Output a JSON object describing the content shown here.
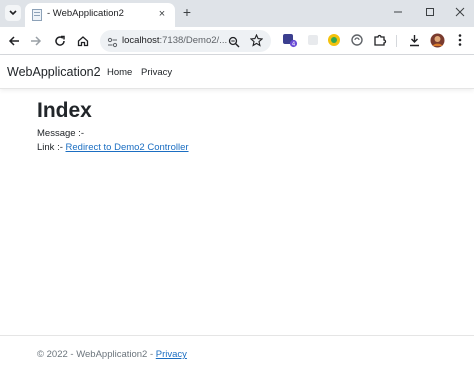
{
  "browser": {
    "tab": {
      "title": "- WebApplication2",
      "close": "×"
    },
    "new_tab": "+",
    "address": {
      "host": "localhost",
      "rest": ":7138/Demo2/..."
    }
  },
  "app": {
    "brand": "WebApplication2",
    "nav": [
      {
        "label": "Home"
      },
      {
        "label": "Privacy"
      }
    ]
  },
  "main": {
    "title": "Index",
    "message_label": "Message :-",
    "link_label": "Link :- ",
    "link_text": "Redirect to Demo2 Controller"
  },
  "footer": {
    "text": "© 2022 - WebApplication2 - ",
    "privacy_link": "Privacy"
  },
  "colors": {
    "link": "#1b6ec2",
    "tabstrip": "#dfe3e8",
    "omnibox": "#eef1f4"
  }
}
